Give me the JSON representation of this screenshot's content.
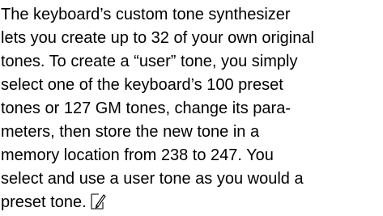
{
  "paragraph": {
    "lines": [
      "The keyboard’s custom tone synthesizer",
      "lets you create up to 32 of your own original",
      "tones. To create a “user” tone, you simply",
      "select one of the keyboard’s 100 preset",
      "tones or 127 GM tones, change its para-",
      "meters, then store the new tone in a",
      "memory location from 238 to 247. You",
      "select and use a user tone as you would a",
      "preset tone."
    ],
    "end_icon": "note-pencil-icon"
  }
}
